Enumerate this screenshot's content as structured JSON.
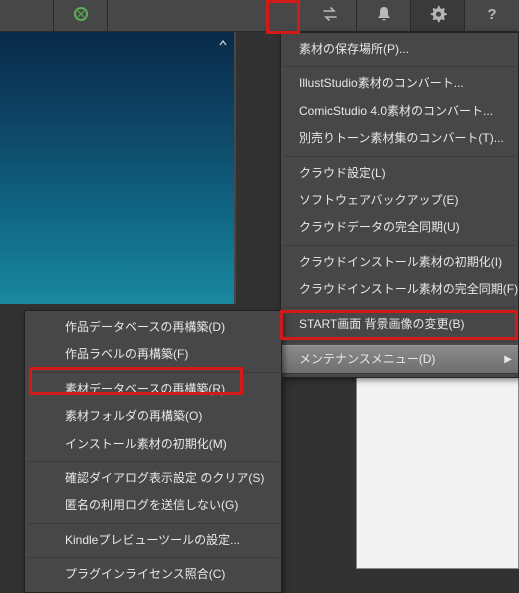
{
  "toolbar": {
    "icons": {
      "brush": "brush-icon",
      "swap": "swap-icon",
      "bell": "bell-icon",
      "gear": "gear-icon",
      "help": "help-icon"
    }
  },
  "mainMenu": {
    "items": [
      {
        "label": "素材の保存場所(P)..."
      },
      {
        "sep": true
      },
      {
        "label": "IllustStudio素材のコンバート..."
      },
      {
        "label": "ComicStudio 4.0素材のコンバート..."
      },
      {
        "label": "別売りトーン素材集のコンバート(T)..."
      },
      {
        "sep": true
      },
      {
        "label": "クラウド設定(L)"
      },
      {
        "label": "ソフトウェアバックアップ(E)"
      },
      {
        "label": "クラウドデータの完全同期(U)"
      },
      {
        "sep": true
      },
      {
        "label": "クラウドインストール素材の初期化(I)"
      },
      {
        "label": "クラウドインストール素材の完全同期(F)"
      },
      {
        "sep": true
      },
      {
        "label": "START画面 背景画像の変更(B)"
      },
      {
        "sep": true
      },
      {
        "label": "メンテナンスメニュー(D)",
        "submenu": true,
        "active": true
      }
    ]
  },
  "subMenu": {
    "items": [
      {
        "label": "作品データベースの再構築(D)"
      },
      {
        "label": "作品ラベルの再構築(F)"
      },
      {
        "sep": true
      },
      {
        "label": "素材データベースの再構築(R)"
      },
      {
        "label": "素材フォルダの再構築(O)"
      },
      {
        "label": "インストール素材の初期化(M)"
      },
      {
        "sep": true
      },
      {
        "label": "確認ダイアログ表示設定 のクリア(S)"
      },
      {
        "label": "匿名の利用ログを送信しない(G)"
      },
      {
        "sep": true
      },
      {
        "label": "Kindleプレビューツールの設定..."
      },
      {
        "sep": true
      },
      {
        "label": "プラグインライセンス照合(C)"
      }
    ]
  }
}
